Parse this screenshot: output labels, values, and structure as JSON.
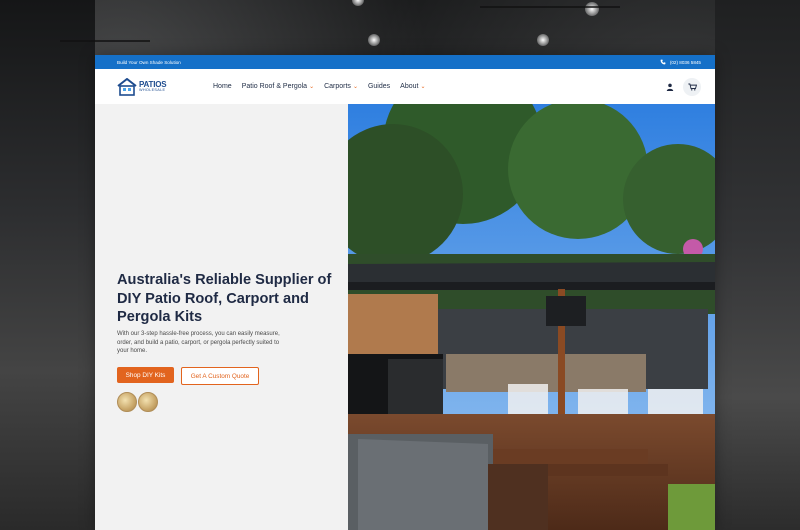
{
  "topbar": {
    "tagline": "Build Your Own Shade Solution",
    "phone": "(02) 8036 5845"
  },
  "logo": {
    "line1": "PATIOS",
    "line2": "WHOLESALE"
  },
  "nav": {
    "items": [
      {
        "label": "Home",
        "dropdown": false
      },
      {
        "label": "Patio Roof & Pergola",
        "dropdown": true
      },
      {
        "label": "Carports",
        "dropdown": true
      },
      {
        "label": "Guides",
        "dropdown": false
      },
      {
        "label": "About",
        "dropdown": true
      }
    ]
  },
  "hero": {
    "title": "Australia's Reliable Supplier of DIY Patio Roof, Carport and Pergola Kits",
    "text": "With our 3-step hassle-free process, you can easily measure, order, and build a patio, carport, or pergola perfectly suited to your home.",
    "primary_button": "Shop DIY Kits",
    "secondary_button": "Get A Custom Quote"
  },
  "icons": {
    "phone": "phone-icon",
    "user": "user-icon",
    "cart": "cart-icon"
  },
  "colors": {
    "topbar": "#1570c8",
    "accent": "#e2641e",
    "heading": "#1f2a44"
  }
}
